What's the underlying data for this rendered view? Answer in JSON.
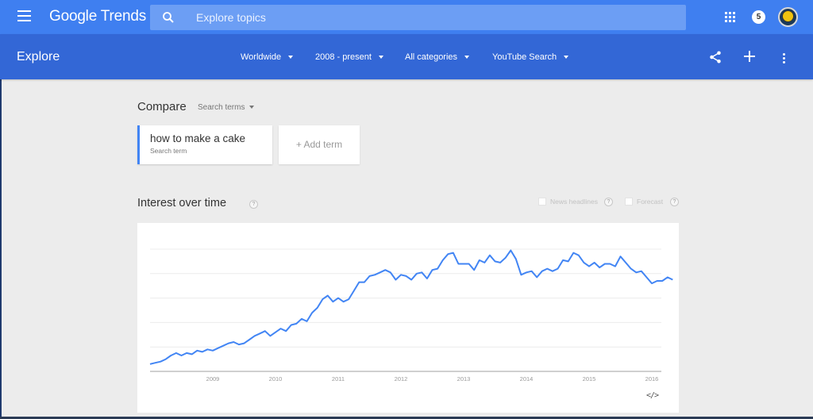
{
  "topbar": {
    "logo": "Google Trends",
    "search_placeholder": "Explore topics",
    "notifications_count": "5",
    "icons": {
      "menu": "hamburger-menu-icon",
      "search": "search-icon",
      "apps": "apps-grid-icon",
      "avatar": "user-avatar"
    }
  },
  "subbar": {
    "title": "Explore",
    "filters": [
      {
        "label": "Worldwide"
      },
      {
        "label": "2008 - present"
      },
      {
        "label": "All categories"
      },
      {
        "label": "YouTube Search"
      }
    ],
    "icons": {
      "share": "share-icon",
      "add": "plus-icon",
      "more": "more-vert-icon"
    }
  },
  "compare": {
    "label": "Compare",
    "type_label": "Search terms",
    "terms": [
      {
        "name": "how to make a cake",
        "type": "Search term",
        "color": "#4285f4"
      }
    ],
    "add_term_label": "+ Add term"
  },
  "interest": {
    "title": "Interest over time",
    "help": "?",
    "options": [
      {
        "label": "News headlines",
        "checked": false
      },
      {
        "label": "Forecast",
        "checked": false
      }
    ],
    "embed_label": "</>"
  },
  "chart_data": {
    "type": "line",
    "title": "Interest over time",
    "xlabel": "",
    "ylabel": "",
    "ylim": [
      0,
      100
    ],
    "grid": true,
    "x_start": "2008-01",
    "x_interval": "month",
    "x_tick_labels": [
      "2009",
      "2010",
      "2011",
      "2012",
      "2013",
      "2014",
      "2015",
      "2016"
    ],
    "series": [
      {
        "name": "how to make a cake",
        "color": "#4285f4",
        "values": [
          6,
          7,
          8,
          10,
          13,
          15,
          13,
          15,
          14,
          17,
          16,
          18,
          17,
          19,
          21,
          23,
          24,
          22,
          23,
          26,
          29,
          31,
          33,
          29,
          32,
          35,
          33,
          38,
          39,
          43,
          41,
          48,
          52,
          59,
          62,
          57,
          60,
          57,
          59,
          66,
          73,
          73,
          78,
          79,
          81,
          83,
          81,
          75,
          79,
          78,
          75,
          80,
          81,
          76,
          83,
          84,
          91,
          96,
          97,
          88,
          88,
          88,
          83,
          91,
          89,
          95,
          90,
          89,
          93,
          99,
          92,
          79,
          81,
          82,
          77,
          82,
          84,
          82,
          84,
          91,
          90,
          97,
          95,
          89,
          86,
          89,
          85,
          88,
          88,
          86,
          94,
          89,
          84,
          81,
          82,
          77,
          72,
          74,
          74,
          77,
          75
        ]
      }
    ]
  }
}
